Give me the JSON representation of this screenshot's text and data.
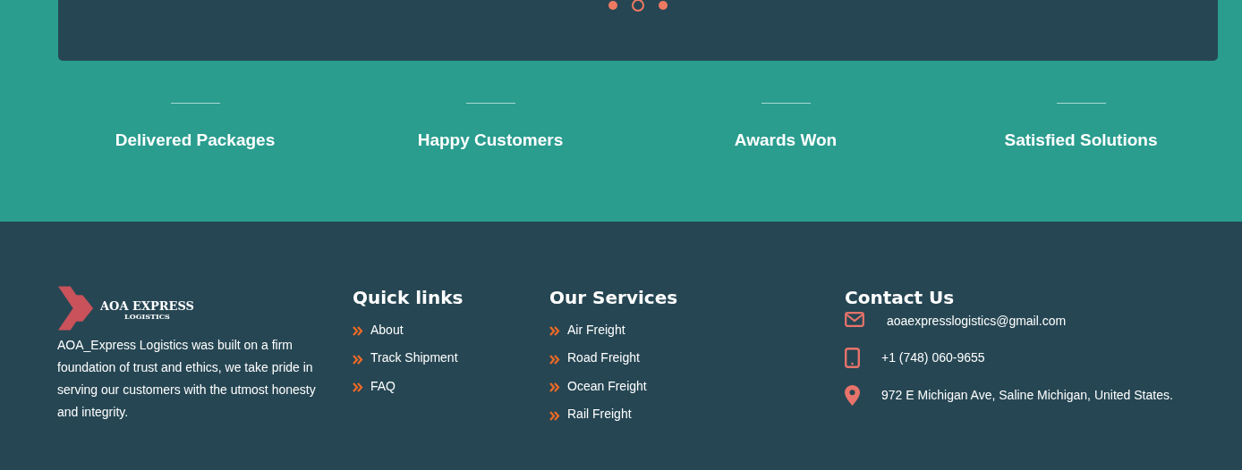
{
  "carousel": {
    "dots": [
      {
        "selected": false
      },
      {
        "selected": true
      },
      {
        "selected": false
      }
    ]
  },
  "stats": [
    {
      "label": "Delivered Packages"
    },
    {
      "label": "Happy Customers"
    },
    {
      "label": "Awards Won"
    },
    {
      "label": "Satisfied Solutions"
    }
  ],
  "footer": {
    "logo": {
      "name": "AOA EXPRESS",
      "tagline": "LOGISTICS"
    },
    "about": "AOA_Express Logistics was built on a firm foundation of trust and ethics, we take pride in serving our customers with the utmost honesty and integrity.",
    "quick_links": {
      "title": "Quick links",
      "items": [
        "About",
        "Track Shipment",
        "FAQ"
      ]
    },
    "services": {
      "title": "Our Services",
      "items": [
        "Air Freight",
        "Road Freight",
        "Ocean Freight",
        "Rail Freight"
      ]
    },
    "contact": {
      "title": "Contact Us",
      "items": [
        {
          "kind": "email",
          "text": "aoaexpresslogistics@gmail.com"
        },
        {
          "kind": "phone",
          "text": "+1 (748) 060-9655"
        },
        {
          "kind": "address",
          "text": "972 E Michigan Ave, Saline Michigan, United States."
        }
      ]
    }
  }
}
